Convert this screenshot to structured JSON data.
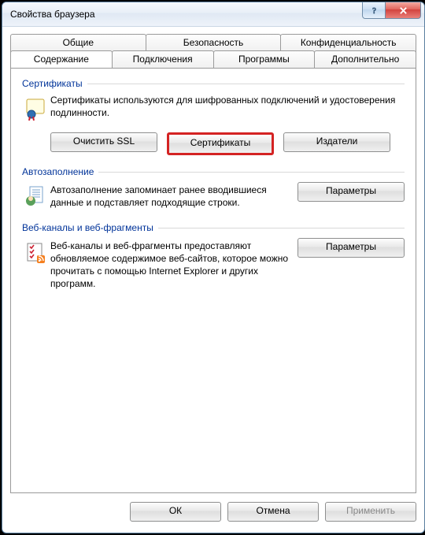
{
  "window": {
    "title": "Свойства браузера"
  },
  "tabs": {
    "row1": [
      "Общие",
      "Безопасность",
      "Конфиденциальность"
    ],
    "row2": [
      "Содержание",
      "Подключения",
      "Программы",
      "Дополнительно"
    ],
    "active": "Содержание"
  },
  "content": {
    "cert": {
      "heading": "Сертификаты",
      "desc": "Сертификаты используются для шифрованных подключений и удостоверения подлинности.",
      "btn_clear": "Очистить SSL",
      "btn_certs": "Сертификаты",
      "btn_pub": "Издатели"
    },
    "autocomplete": {
      "heading": "Автозаполнение",
      "desc": "Автозаполнение запоминает ранее вводившиеся данные и подставляет подходящие строки.",
      "btn": "Параметры"
    },
    "feeds": {
      "heading": "Веб-каналы и веб-фрагменты",
      "desc": "Веб-каналы и веб-фрагменты предоставляют обновляемое содержимое веб-сайтов, которое можно прочитать с помощью Internet Explorer и других программ.",
      "btn": "Параметры"
    }
  },
  "footer": {
    "ok": "ОК",
    "cancel": "Отмена",
    "apply": "Применить"
  }
}
